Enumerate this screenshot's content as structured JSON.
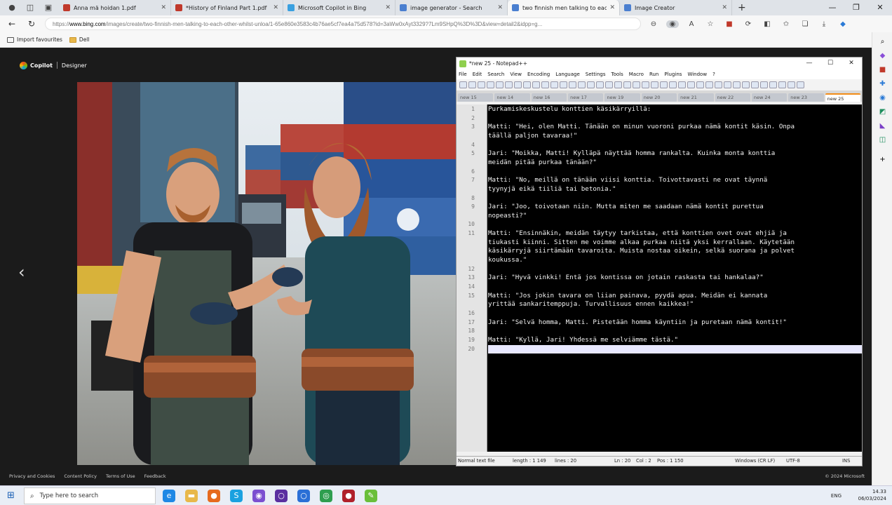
{
  "browser": {
    "tabs": [
      {
        "title": "Anna mä hoidan 1.pdf",
        "color": "#c0392b"
      },
      {
        "title": "*History of Finland Part 1.pdf",
        "color": "#c0392b"
      },
      {
        "title": "Microsoft Copilot in Bing",
        "color": "#3aa0e0"
      },
      {
        "title": "image generator - Search",
        "color": "#4a7fd0"
      },
      {
        "title": "two finnish men talking to each",
        "color": "#4a7fd0"
      },
      {
        "title": "Image Creator",
        "color": "#4a7fd0"
      }
    ],
    "active_tab": 4,
    "new_tab_label": "+",
    "url_prefix": "https://",
    "url_host": "www.bing.com",
    "url_rest": "/images/create/two-finnish-men-talking-to-each-other-whilst-unloa/1-65e860e3583c4b76ae5cf7ea4a75d578?id=3aWw0xAyt3329?7Lm9SHpQ%3D%3D&view=detail2&idpp=g...",
    "favorites": [
      {
        "label": "Import favourites",
        "icon": "import-icon"
      },
      {
        "label": "Dell",
        "icon": "folder-icon"
      }
    ]
  },
  "designer": {
    "brand": "Copilot",
    "product": "Designer",
    "prev_arrow": "‹",
    "footer_links": [
      "Privacy and Cookies",
      "Content Policy",
      "Terms of Use",
      "Feedback"
    ],
    "copyright": "© 2024 Microsoft"
  },
  "notepad": {
    "title": "*new 25 - Notepad++",
    "menu": [
      "File",
      "Edit",
      "Search",
      "View",
      "Encoding",
      "Language",
      "Settings",
      "Tools",
      "Macro",
      "Run",
      "Plugins",
      "Window",
      "?"
    ],
    "doc_tabs": [
      "new 15",
      "new 14",
      "new 16",
      "new 17",
      "new 19",
      "new 20",
      "new 21",
      "new 22",
      "new 24",
      "new 23",
      "new 25"
    ],
    "lines": [
      {
        "n": "1",
        "text": "Purkamiskeskustelu konttien käsikärryillä:"
      },
      {
        "n": "2",
        "text": ""
      },
      {
        "n": "3",
        "text": "Matti: \"Hei, olen Matti. Tänään on minun vuoroni purkaa nämä kontit käsin. Onpa"
      },
      {
        "n": "",
        "text": "täällä paljon tavaraa!\""
      },
      {
        "n": "4",
        "text": ""
      },
      {
        "n": "5",
        "text": "Jari: \"Moikka, Matti! Kylläpä näyttää homma rankalta. Kuinka monta konttia"
      },
      {
        "n": "",
        "text": "meidän pitää purkaa tänään?\""
      },
      {
        "n": "6",
        "text": ""
      },
      {
        "n": "7",
        "text": "Matti: \"No, meillä on tänään viisi konttia. Toivottavasti ne ovat täynnä"
      },
      {
        "n": "",
        "text": "tyynyjä eikä tiiliä tai betonia.\""
      },
      {
        "n": "8",
        "text": ""
      },
      {
        "n": "9",
        "text": "Jari: \"Joo, toivotaan niin. Mutta miten me saadaan nämä kontit purettua"
      },
      {
        "n": "",
        "text": "nopeasti?\""
      },
      {
        "n": "10",
        "text": ""
      },
      {
        "n": "11",
        "text": "Matti: \"Ensinnäkin, meidän täytyy tarkistaa, että konttien ovet ovat ehjiä ja"
      },
      {
        "n": "",
        "text": "tiukasti kiinni. Sitten me voimme alkaa purkaa niitä yksi kerrallaan. Käytetään"
      },
      {
        "n": "",
        "text": "käsikärryjä siirtämään tavaroita. Muista nostaa oikein, selkä suorana ja polvet"
      },
      {
        "n": "",
        "text": "koukussa.\""
      },
      {
        "n": "12",
        "text": ""
      },
      {
        "n": "13",
        "text": "Jari: \"Hyvä vinkki! Entä jos kontissa on jotain raskasta tai hankalaa?\""
      },
      {
        "n": "14",
        "text": ""
      },
      {
        "n": "15",
        "text": "Matti: \"Jos jokin tavara on liian painava, pyydä apua. Meidän ei kannata"
      },
      {
        "n": "",
        "text": "yrittää sankaritemppuja. Turvallisuus ennen kaikkea!\""
      },
      {
        "n": "16",
        "text": ""
      },
      {
        "n": "17",
        "text": "Jari: \"Selvä homma, Matti. Pistetään homma käyntiin ja puretaan nämä kontit!\""
      },
      {
        "n": "18",
        "text": ""
      },
      {
        "n": "19",
        "text": "Matti: \"Kyllä, Jari! Yhdessä me selviämme tästä.\""
      },
      {
        "n": "20",
        "text": ""
      }
    ],
    "status": {
      "type": "Normal text file",
      "length": "length : 1 149",
      "lines": "lines : 20",
      "ln": "Ln : 20",
      "col": "Col : 2",
      "pos": "Pos : 1 150",
      "eol": "Windows (CR LF)",
      "enc": "UTF-8",
      "mode": "INS"
    }
  },
  "taskbar": {
    "search_placeholder": "Type here to search",
    "lang": "ENG",
    "time": "14.33",
    "date": "06/03/2024"
  }
}
